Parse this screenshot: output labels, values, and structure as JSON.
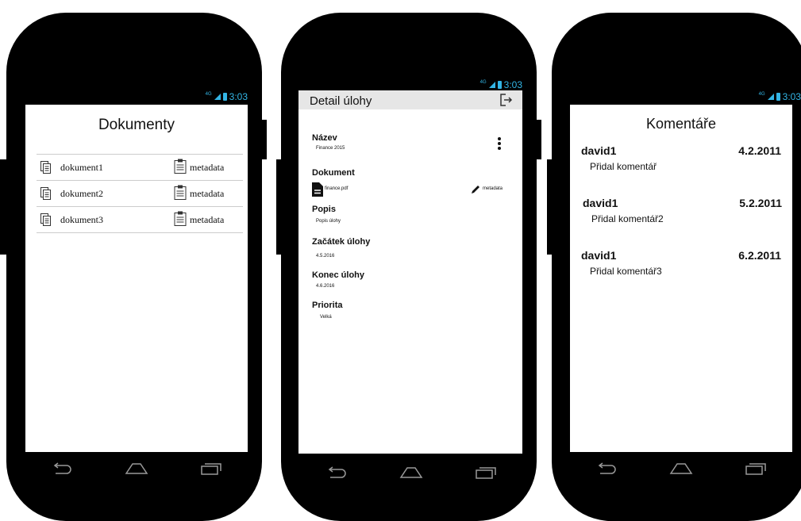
{
  "status_bar": {
    "network": "4G",
    "time": "3:03"
  },
  "colors": {
    "status_accent": "#33b5e5",
    "appbar_bg": "#e6e6e6"
  },
  "screen1": {
    "title": "Dokumenty",
    "documents": [
      {
        "name": "dokument1",
        "meta_label": "metadata"
      },
      {
        "name": "dokument2",
        "meta_label": "metadata"
      },
      {
        "name": "dokument3",
        "meta_label": "metadata"
      }
    ]
  },
  "screen2": {
    "title": "Detail úlohy",
    "fields": {
      "nazev": {
        "label": "Název",
        "value": "Finance 2015"
      },
      "dokument": {
        "label": "Dokument",
        "file": "finance.pdf",
        "meta_label": "metadata"
      },
      "popis": {
        "label": "Popis",
        "value": "Popis úlohy"
      },
      "zacatek": {
        "label": "Začátek úlohy",
        "value": "4.5.2016"
      },
      "konec": {
        "label": "Konec úlohy",
        "value": "4.6.2016"
      },
      "priorita": {
        "label": "Priorita",
        "value": "Velká"
      }
    }
  },
  "screen3": {
    "title": "Komentáře",
    "comments": [
      {
        "author": "david1",
        "date": "4.2.2011",
        "text": "Přidal komentář"
      },
      {
        "author": "david1",
        "date": "5.2.2011",
        "text": "Přidal komentář2"
      },
      {
        "author": "david1",
        "date": "6.2.2011",
        "text": "Přidal komentář3"
      }
    ]
  },
  "icons": [
    "back-icon",
    "home-icon",
    "recents-icon",
    "document-icon",
    "clipboard-icon",
    "logout-icon",
    "more-vert-icon",
    "pdf-file-icon",
    "pencil-icon"
  ]
}
